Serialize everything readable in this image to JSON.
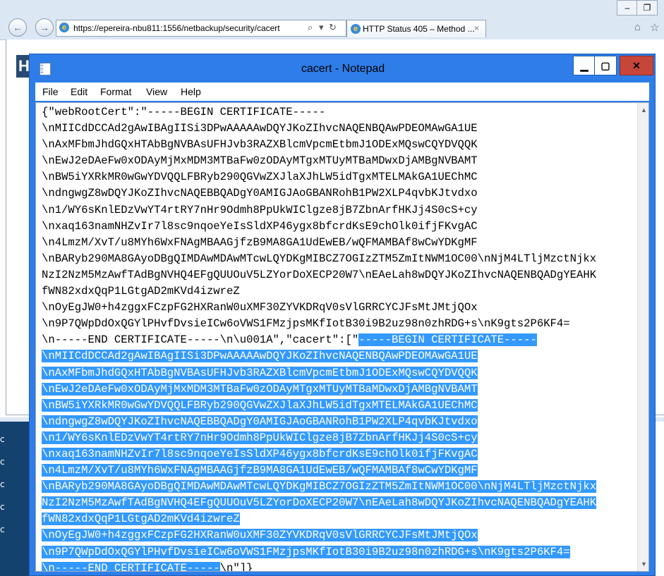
{
  "browser": {
    "url": "https://epereira-nbu811:1556/netbackup/security/cacert",
    "tab_title": "HTTP Status 405 – Method ...",
    "tab_close": "×",
    "back_glyph": "←",
    "forward_glyph": "→",
    "search_glyph": "⌕",
    "refresh_glyph": "↻",
    "dropdown_glyph": "▾",
    "home_glyph": "⌂",
    "favorites_glyph": "☆",
    "tools_glyph": "⚙",
    "win_min": "‒",
    "win_restore": "❐",
    "page_heading_char": "H"
  },
  "desktop": {
    "side_chars": [
      "c",
      "c",
      "c",
      "c",
      "c"
    ]
  },
  "notepad": {
    "title": "cacert - Notepad",
    "min_glyph": "▁",
    "max_glyph": "▢",
    "close_glyph": "✕",
    "menu": [
      "File",
      "Edit",
      "Format",
      "View",
      "Help"
    ],
    "scroll_up": "▲",
    "scroll_down": "▼",
    "lines": [
      {
        "plain": "{\"webRootCert\":\"-----BEGIN CERTIFICATE-----",
        "sel": "",
        "tail": ""
      },
      {
        "plain": "\\nMIICdDCCAd2gAwIBAgIISi3DPwAAAAAwDQYJKoZIhvcNAQENBQAwPDEOMAwGA1UE",
        "sel": "",
        "tail": ""
      },
      {
        "plain": "\\nAxMFbmJhdGQxHTAbBgNVBAsUFHJvb3RAZXBlcmVpcmEtbmJ1ODExMQswCQYDVQQK",
        "sel": "",
        "tail": ""
      },
      {
        "plain": "\\nEwJ2eDAeFw0xODAyMjMxMDM3MTBaFw0zODAyMTgxMTUyMTBaMDwxDjAMBgNVBAMT",
        "sel": "",
        "tail": ""
      },
      {
        "plain": "\\nBW5iYXRkMR0wGwYDVQQLFBRyb290QGVwZXJlaXJhLW5idTgxMTELMAkGA1UEChMC",
        "sel": "",
        "tail": ""
      },
      {
        "plain": "\\ndngwgZ8wDQYJKoZIhvcNAQEBBQADgY0AMIGJAoGBANRohB1PW2XLP4qvbKJtvdxo",
        "sel": "",
        "tail": ""
      },
      {
        "plain": "\\n1/WY6sKnlEDzVwYT4rtRY7nHr9Odmh8PpUkWIClgze8jB7ZbnArfHKJj4S0cS+cy",
        "sel": "",
        "tail": ""
      },
      {
        "plain": "\\nxaq163namNHZvIr7l8sc9nqoeYeIsSldXP46ygx8bfcrdKsE9chOlk0ifjFKvgAC",
        "sel": "",
        "tail": ""
      },
      {
        "plain": "\\n4LmzM/XvT/u8MYh6WxFNAgMBAAGjfzB9MA8GA1UdEwEB/wQFMAMBAf8wCwYDKgMF",
        "sel": "",
        "tail": ""
      },
      {
        "plain": "\\nBARyb290MA8GAyoDBgQIMDAwMDAwMTcwLQYDKgMIBCZ7OGIzZTM5ZmItNWM1OC00\\nNjM4LTljMzctNjkx",
        "sel": "",
        "tail": ""
      },
      {
        "plain": "NzI2NzM5MzAwfTAdBgNVHQ4EFgQUUOuV5LZYorDoXECP20W7\\nEAeLah8wDQYJKoZIhvcNAQENBQADgYEAHK",
        "sel": "",
        "tail": ""
      },
      {
        "plain": "fWN82xdxQqP1LGtgAD2mKVd4izwreZ",
        "sel": "",
        "tail": ""
      },
      {
        "plain": "\\nOyEgJW0+h4zggxFCzpFG2HXRanW0uXMF30ZYVKDRqV0sVlGRRCYCJFsMtJMtjQOx",
        "sel": "",
        "tail": ""
      },
      {
        "plain": "\\n9P7QWpDdOxQGYlPHvfDvsieICw6oVWS1FMzjpsMKfIotB30i9B2uz98n0zhRDG+s\\nK9gts2P6KF4=",
        "sel": "",
        "tail": ""
      },
      {
        "plain": "\\n-----END CERTIFICATE-----\\n\\u001A\",\"cacert\":[\"",
        "sel": "-----BEGIN CERTIFICATE-----",
        "tail": ""
      },
      {
        "plain": "",
        "sel": "\\nMIICdDCCAd2gAwIBAgIISi3DPwAAAAAwDQYJKoZIhvcNAQENBQAwPDEOMAwGA1UE",
        "tail": ""
      },
      {
        "plain": "",
        "sel": "\\nAxMFbmJhdGQxHTAbBgNVBAsUFHJvb3RAZXBlcmVpcmEtbmJ1ODExMQswCQYDVQQK",
        "tail": ""
      },
      {
        "plain": "",
        "sel": "\\nEwJ2eDAeFw0xODAyMjMxMDM3MTBaFw0zODAyMTgxMTUyMTBaMDwxDjAMBgNVBAMT",
        "tail": ""
      },
      {
        "plain": "",
        "sel": "\\nBW5iYXRkMR0wGwYDVQQLFBRyb290QGVwZXJlaXJhLW5idTgxMTELMAkGA1UEChMC",
        "tail": ""
      },
      {
        "plain": "",
        "sel": "\\ndngwgZ8wDQYJKoZIhvcNAQEBBQADgY0AMIGJAoGBANRohB1PW2XLP4qvbKJtvdxo",
        "tail": ""
      },
      {
        "plain": "",
        "sel": "\\n1/WY6sKnlEDzVwYT4rtRY7nHr9Odmh8PpUkWIClgze8jB7ZbnArfHKJj4S0cS+cy",
        "tail": ""
      },
      {
        "plain": "",
        "sel": "\\nxaq163namNHZvIr7l8sc9nqoeYeIsSldXP46ygx8bfcrdKsE9chOlk0ifjFKvgAC",
        "tail": ""
      },
      {
        "plain": "",
        "sel": "\\n4LmzM/XvT/u8MYh6WxFNAgMBAAGjfzB9MA8GA1UdEwEB/wQFMAMBAf8wCwYDKgMF",
        "tail": ""
      },
      {
        "plain": "",
        "sel": "\\nBARyb290MA8GAyoDBgQIMDAwMDAwMTcwLQYDKgMIBCZ7OGIzZTM5ZmItNWM1OC00\\nNjM4LTljMzctNjkx",
        "tail": ""
      },
      {
        "plain": "",
        "sel": "NzI2NzM5MzAwfTAdBgNVHQ4EFgQUUOuV5LZYorDoXECP20W7\\nEAeLah8wDQYJKoZIhvcNAQENBQADgYEAHK",
        "tail": ""
      },
      {
        "plain": "",
        "sel": "fWN82xdxQqP1LGtgAD2mKVd4izwreZ",
        "tail": ""
      },
      {
        "plain": "",
        "sel": "\\nOyEgJW0+h4zggxFCzpFG2HXRanW0uXMF30ZYVKDRqV0sVlGRRCYCJFsMtJMtjQOx",
        "tail": ""
      },
      {
        "plain": "",
        "sel": "\\n9P7QWpDdOxQGYlPHvfDvsieICw6oVWS1FMzjpsMKfIotB30i9B2uz98n0zhRDG+s\\nK9gts2P6KF4=",
        "tail": ""
      },
      {
        "plain": "",
        "sel": "\\n-----END CERTIFICATE-----",
        "tail": "\\n\"]}"
      }
    ]
  },
  "colors": {
    "selection_bg": "#3399ff",
    "notepad_frame": "#2e7de9",
    "close_button": "#c7463a"
  }
}
